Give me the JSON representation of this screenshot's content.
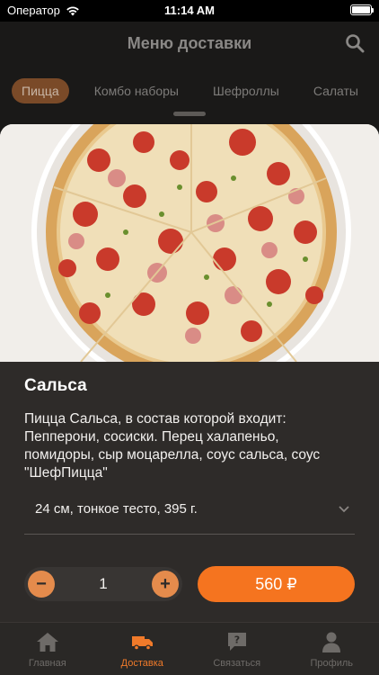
{
  "status": {
    "carrier": "Оператор",
    "time": "11:14 AM"
  },
  "header": {
    "title": "Меню доставки"
  },
  "categories": [
    {
      "label": "Пицца",
      "active": true
    },
    {
      "label": "Комбо наборы",
      "active": false
    },
    {
      "label": "Шефроллы",
      "active": false
    },
    {
      "label": "Салаты",
      "active": false
    }
  ],
  "product": {
    "title": "Сальса",
    "description": "Пицца Сальса, в состав которой входит: Пепперони, сосиски. Перец халапеньо, помидоры, сыр моцарелла, соус сальса, соус \"ШефПицца\"",
    "size_option": "24 см, тонкое тесто, 395 г.",
    "quantity": "1",
    "minus": "−",
    "plus": "+",
    "price": "560 ₽"
  },
  "tabs": [
    {
      "label": "Главная",
      "icon": "home-icon",
      "active": false
    },
    {
      "label": "Доставка",
      "icon": "delivery-truck-icon",
      "active": true
    },
    {
      "label": "Связаться",
      "icon": "chat-icon",
      "active": false
    },
    {
      "label": "Профиль",
      "icon": "person-icon",
      "active": false
    }
  ],
  "colors": {
    "accent": "#f5741f",
    "sheet": "#2e2b29",
    "stepper": "#e48b4c"
  }
}
